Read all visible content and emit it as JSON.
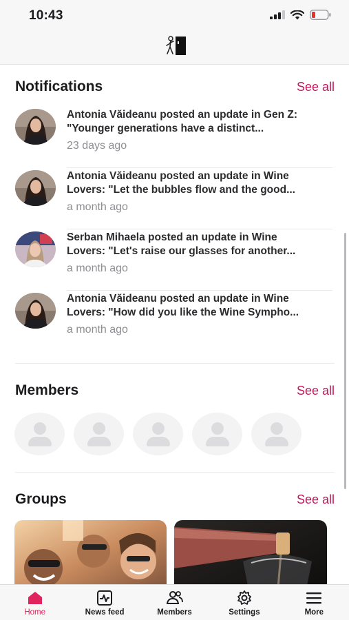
{
  "status_bar": {
    "time": "10:43"
  },
  "notifications": {
    "title": "Notifications",
    "see_all": "See all",
    "items": [
      {
        "line1": "Antonia Văideanu posted an update in Gen Z:",
        "line2": "\"Younger generations have a distinct...",
        "time": "23 days ago"
      },
      {
        "line1": "Antonia Văideanu posted an update in Wine",
        "line2": "Lovers: \"Let the bubbles flow and the good...",
        "time": "a month ago"
      },
      {
        "line1": "Serban Mihaela posted an update in Wine",
        "line2": "Lovers: \"Let's raise our glasses for another...",
        "time": "a month ago"
      },
      {
        "line1": "Antonia Văideanu posted an update in Wine",
        "line2": "Lovers: \"How did you like the Wine Sympho...",
        "time": "a month ago"
      }
    ]
  },
  "members": {
    "title": "Members",
    "see_all": "See all"
  },
  "groups": {
    "title": "Groups",
    "see_all": "See all"
  },
  "tabbar": {
    "items": [
      {
        "label": "Home",
        "icon": "home-icon",
        "active": true
      },
      {
        "label": "News feed",
        "icon": "activity-icon"
      },
      {
        "label": "Members",
        "icon": "people-icon"
      },
      {
        "label": "Settings",
        "icon": "gear-icon"
      },
      {
        "label": "More",
        "icon": "menu-icon"
      }
    ]
  },
  "colors": {
    "accent": "#c2185b",
    "tab_active": "#e0245e",
    "muted": "#8e8e93"
  }
}
